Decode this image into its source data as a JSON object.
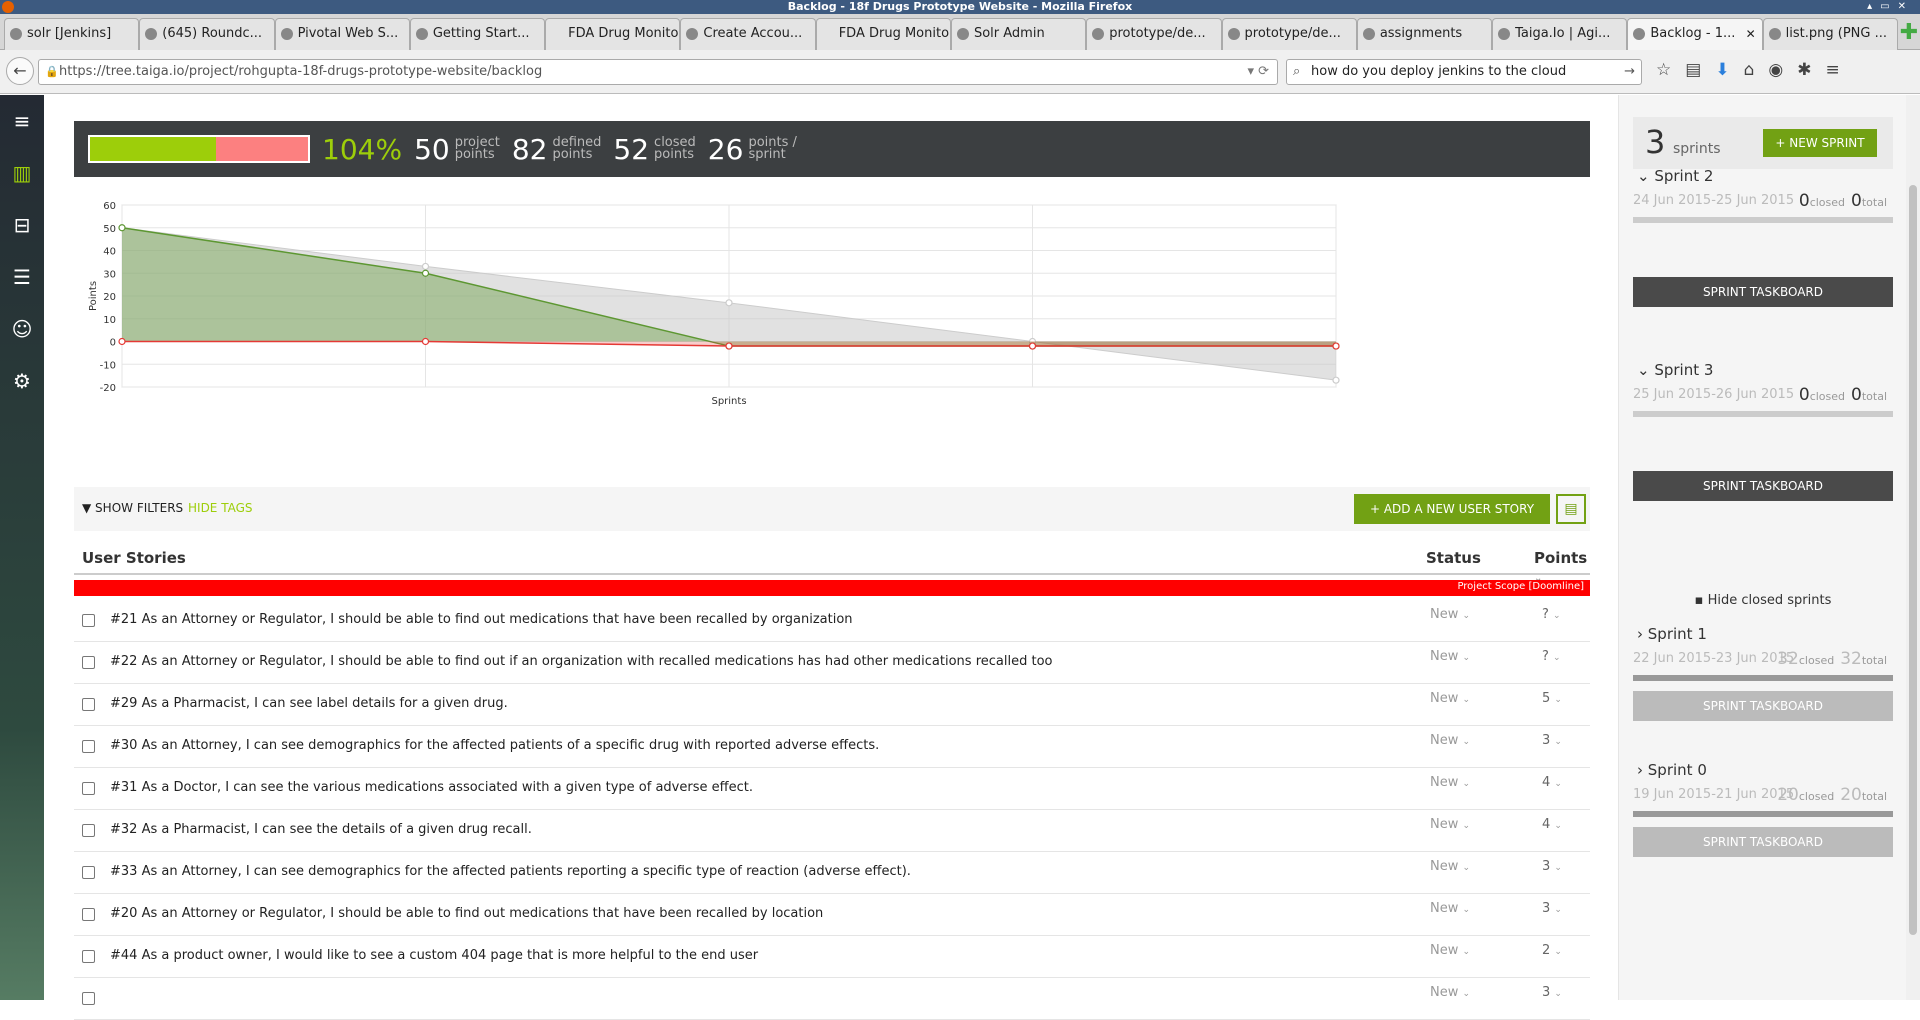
{
  "window": {
    "title": "Backlog - 18f Drugs Prototype Website - Mozilla Firefox"
  },
  "tabs": [
    {
      "label": "solr [Jenkins]"
    },
    {
      "label": "(645) Roundc..."
    },
    {
      "label": "Pivotal Web S..."
    },
    {
      "label": "Getting Start..."
    },
    {
      "label": "FDA Drug Monitor"
    },
    {
      "label": "Create Accou..."
    },
    {
      "label": "FDA Drug Monitor"
    },
    {
      "label": "Solr Admin"
    },
    {
      "label": "prototype/de..."
    },
    {
      "label": "prototype/de..."
    },
    {
      "label": "assignments"
    },
    {
      "label": "Taiga.Io | Agi..."
    },
    {
      "label": "Backlog - 1..."
    },
    {
      "label": "list.png (PNG ..."
    }
  ],
  "nav": {
    "url": "https://tree.taiga.io/project/rohgupta-18f-drugs-prototype-website/backlog",
    "search": "how do you deploy jenkins to the cloud"
  },
  "sidebar": {
    "items": [
      "menu-icon",
      "backlog-icon",
      "kanban-icon",
      "wiki-icon",
      "team-icon",
      "settings-icon"
    ]
  },
  "summary": {
    "progress_fraction": 1.0,
    "percent": "104%",
    "project_points": "50",
    "project_label_1": "project",
    "project_label_2": "points",
    "defined_points": "82",
    "defined_label_1": "defined",
    "defined_label_2": "points",
    "closed_points": "52",
    "closed_label_1": "closed",
    "closed_label_2": "points",
    "points_per_sprint": "26",
    "pps_label_1": "points /",
    "pps_label_2": "sprint",
    "colors": {
      "closed": "#9dce0a",
      "remaining": "#fc8080"
    }
  },
  "chart_data": {
    "type": "area",
    "xlabel": "Sprints",
    "ylabel": "Points",
    "ylim": [
      -20,
      60
    ],
    "yticks": [
      60,
      50,
      40,
      30,
      20,
      10,
      0,
      -10,
      -20
    ],
    "x": [
      0,
      1,
      2,
      3,
      4
    ],
    "series": [
      {
        "values": [
          50,
          33,
          17,
          0,
          -17
        ],
        "color": "#cccccc"
      },
      {
        "values": [
          50,
          30,
          -2,
          -2,
          -2
        ],
        "color": "#5d9732"
      },
      {
        "values": [
          0,
          0,
          -2,
          -2,
          -2
        ],
        "color": "#e53935"
      }
    ]
  },
  "filters": {
    "show_filters": "SHOW FILTERS",
    "hide_tags": "HIDE TAGS",
    "add_story": "+ ADD A NEW USER STORY"
  },
  "table": {
    "col_stories": "User Stories",
    "col_status": "Status",
    "col_points": "Points",
    "doomline": "Project Scope [Doomline]",
    "rows": [
      {
        "text": "#21 As an Attorney or Regulator, I should be able to find out medications that have been recalled by organization",
        "status": "New",
        "points": "?"
      },
      {
        "text": "#22 As an Attorney or Regulator, I should be able to find out if an organization with recalled medications has had other medications recalled too",
        "status": "New",
        "points": "?"
      },
      {
        "text": "#29 As a Pharmacist, I can see label details for a given drug.",
        "status": "New",
        "points": "5"
      },
      {
        "text": "#30 As an Attorney, I can see demographics for the affected patients of a specific drug with reported adverse effects.",
        "status": "New",
        "points": "3"
      },
      {
        "text": "#31 As a Doctor, I can see the various medications associated with a given type of adverse effect.",
        "status": "New",
        "points": "4"
      },
      {
        "text": "#32 As a Pharmacist, I can see the details of a given drug recall.",
        "status": "New",
        "points": "4"
      },
      {
        "text": "#33 As an Attorney, I can see demographics for the affected patients reporting a specific type of reaction (adverse effect).",
        "status": "New",
        "points": "3"
      },
      {
        "text": "#20 As an Attorney or Regulator, I should be able to find out medications that have been recalled by location",
        "status": "New",
        "points": "3"
      },
      {
        "text": "#44 As a product owner, I would like to see a custom 404 page that is more helpful to the end user",
        "status": "New",
        "points": "2"
      },
      {
        "text": "",
        "status": "New",
        "points": "3"
      }
    ]
  },
  "sprints_panel": {
    "count": "3",
    "count_label": "sprints",
    "new_sprint": "+ NEW SPRINT",
    "hide_closed": "Hide closed sprints",
    "taskboard": "SPRINT TASKBOARD",
    "closed_label": "closed",
    "total_label": "total",
    "open": [
      {
        "name": "Sprint 2",
        "dates": "24 Jun 2015-25 Jun 2015",
        "closed": "0",
        "total": "0"
      },
      {
        "name": "Sprint 3",
        "dates": "25 Jun 2015-26 Jun 2015",
        "closed": "0",
        "total": "0"
      }
    ],
    "closed": [
      {
        "name": "Sprint 1",
        "dates": "22 Jun 2015-23 Jun 2015",
        "closed": "32",
        "total": "32"
      },
      {
        "name": "Sprint 0",
        "dates": "19 Jun 2015-21 Jun 2015",
        "closed": "20",
        "total": "20"
      }
    ]
  }
}
